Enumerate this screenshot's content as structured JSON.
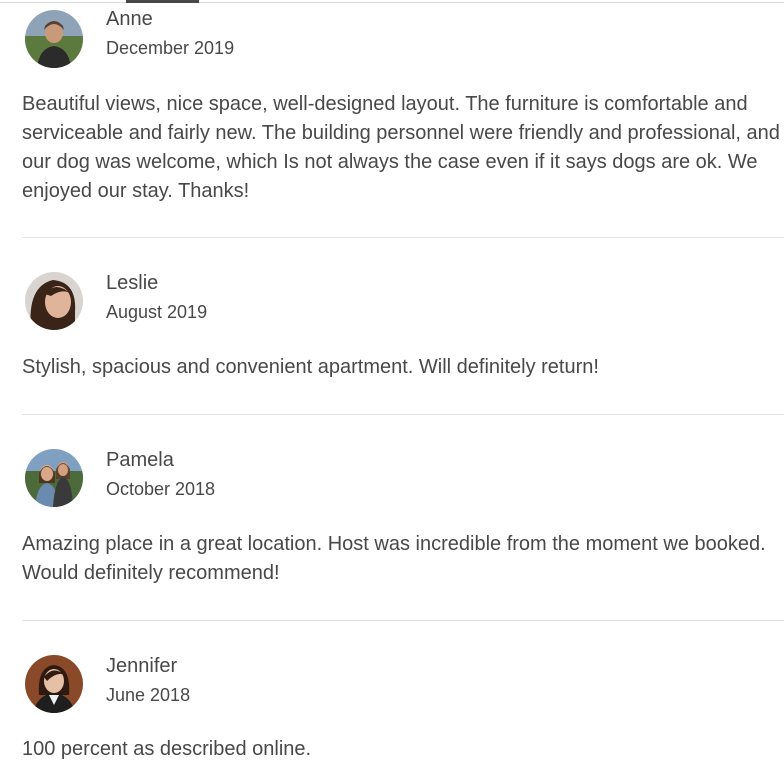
{
  "reviews": [
    {
      "name": "Anne",
      "date": "December 2019",
      "text": "Beautiful views, nice space, well-designed layout. The furniture is comfortable and serviceable and fairly new. The building personnel were friendly and professional, and our dog was welcome, which Is not always the case even if it says dogs are ok. We enjoyed our stay. Thanks!",
      "avatar": "avatar-photo"
    },
    {
      "name": "Leslie",
      "date": "August 2019",
      "text": "Stylish, spacious and convenient apartment. Will definitely return!",
      "avatar": "avatar-photo"
    },
    {
      "name": "Pamela",
      "date": "October 2018",
      "text": "Amazing place in a great location. Host was incredible from the moment we booked. Would definitely recommend!",
      "avatar": "avatar-photo"
    },
    {
      "name": "Jennifer",
      "date": "June 2018",
      "text": "100 percent as described online.",
      "avatar": "avatar-photo"
    }
  ],
  "colors": {
    "text": "#484848",
    "divider": "#e4e4e4"
  }
}
